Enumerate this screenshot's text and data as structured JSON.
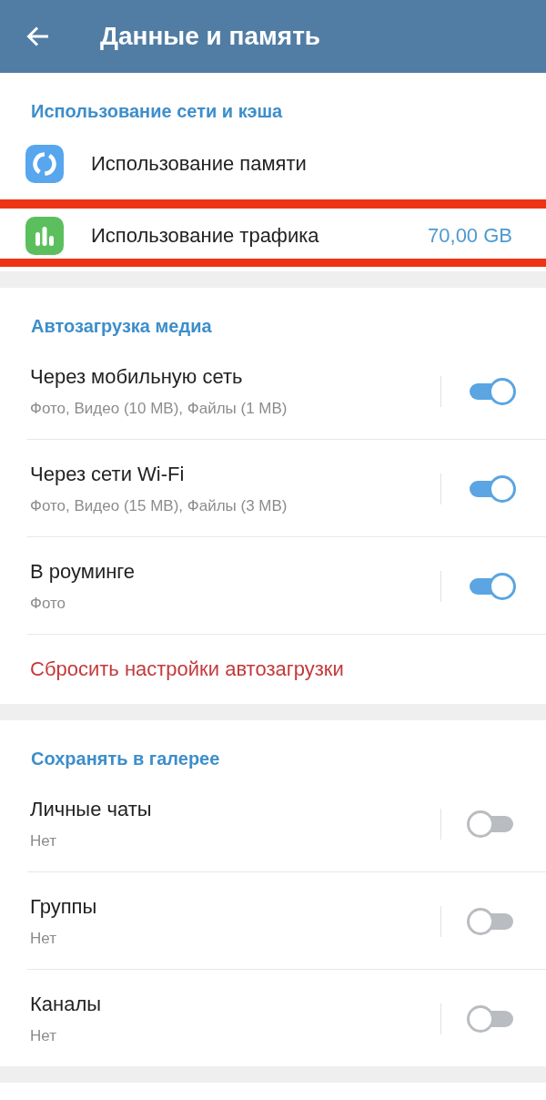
{
  "app_bar": {
    "title": "Данные и память"
  },
  "sections": [
    {
      "title": "Использование сети и кэша",
      "items": [
        {
          "kind": "nav",
          "label": "Использование памяти",
          "highlighted": false
        },
        {
          "kind": "nav",
          "label": "Использование трафика",
          "value": "70,00 GB",
          "highlighted": true
        }
      ]
    },
    {
      "title": "Автозагрузка медиа",
      "items": [
        {
          "kind": "toggle",
          "label": "Через мобильную сеть",
          "detail": "Фото, Видео (10 MB), Файлы (1 MB)",
          "on": true
        },
        {
          "kind": "toggle",
          "label": "Через сети Wi-Fi",
          "detail": "Фото, Видео (15 MB), Файлы (3 MB)",
          "on": true
        },
        {
          "kind": "toggle",
          "label": "В роуминге",
          "detail": "Фото",
          "on": true
        },
        {
          "kind": "action",
          "label": "Сбросить настройки автозагрузки"
        }
      ]
    },
    {
      "title": "Сохранять в галерее",
      "items": [
        {
          "kind": "toggle",
          "label": "Личные чаты",
          "detail": "Нет",
          "on": false
        },
        {
          "kind": "toggle",
          "label": "Группы",
          "detail": "Нет",
          "on": false
        },
        {
          "kind": "toggle",
          "label": "Каналы",
          "detail": "Нет",
          "on": false
        }
      ]
    }
  ]
}
